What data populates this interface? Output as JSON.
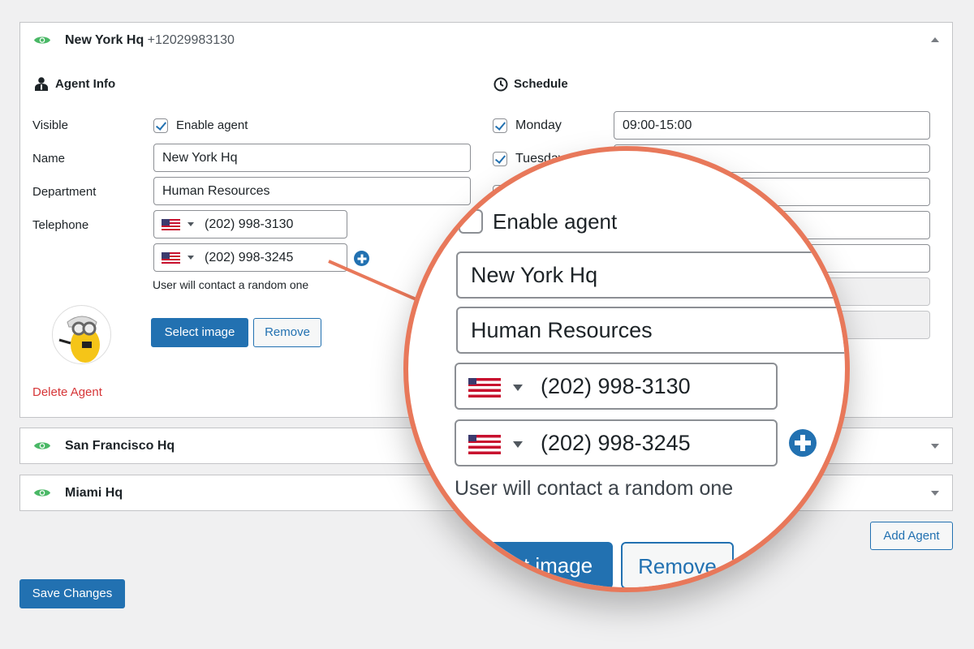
{
  "agents": [
    {
      "name": "New York Hq",
      "phone": "+12029983130",
      "expanded": true
    },
    {
      "name": "San Francisco Hq",
      "expanded": false
    },
    {
      "name": "Miami Hq",
      "expanded": false
    }
  ],
  "agent_info": {
    "heading": "Agent Info",
    "visible_label": "Visible",
    "enable_label": "Enable agent",
    "enabled": true,
    "name_label": "Name",
    "name_value": "New York Hq",
    "department_label": "Department",
    "department_value": "Human Resources",
    "telephone_label": "Telephone",
    "phones": [
      "(202) 998-3130",
      "(202) 998-3245"
    ],
    "helper": "User will contact a random one",
    "select_image": "Select image",
    "remove": "Remove",
    "delete": "Delete Agent"
  },
  "schedule": {
    "heading": "Schedule",
    "days": [
      {
        "label": "Monday",
        "checked": true,
        "hours": "09:00-15:00"
      },
      {
        "label": "Tuesday",
        "checked": true,
        "hours": ""
      }
    ]
  },
  "add_agent": "Add Agent",
  "save_changes": "Save Changes",
  "colors": {
    "accent": "#2271b1",
    "eye": "#4ab866",
    "delete": "#d63638",
    "magnifier": "#e8785a"
  }
}
